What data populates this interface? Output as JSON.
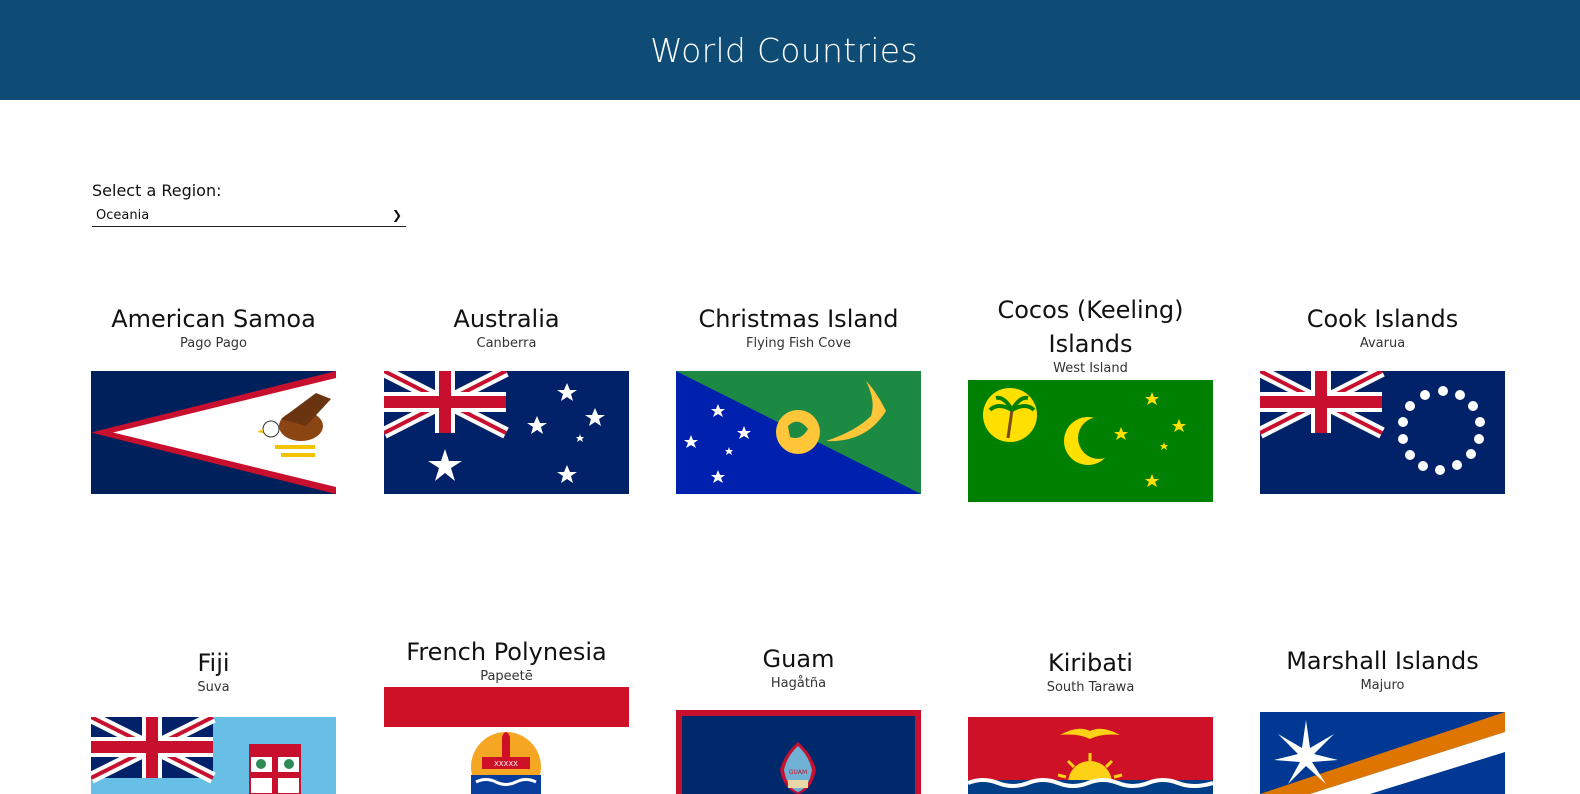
{
  "header": {
    "title": "World Countries"
  },
  "region_filter": {
    "label": "Select a Region:",
    "selected": "Oceania"
  },
  "countries": [
    {
      "name": "American Samoa",
      "capital": "Pago Pago",
      "flag_icon": "american-samoa-flag"
    },
    {
      "name": "Australia",
      "capital": "Canberra",
      "flag_icon": "australia-flag"
    },
    {
      "name": "Christmas Island",
      "capital": "Flying Fish Cove",
      "flag_icon": "christmas-island-flag"
    },
    {
      "name": "Cocos (Keeling) Islands",
      "capital": "West Island",
      "flag_icon": "cocos-keeling-islands-flag"
    },
    {
      "name": "Cook Islands",
      "capital": "Avarua",
      "flag_icon": "cook-islands-flag"
    },
    {
      "name": "Fiji",
      "capital": "Suva",
      "flag_icon": "fiji-flag"
    },
    {
      "name": "French Polynesia",
      "capital": "Papeetē",
      "flag_icon": "french-polynesia-flag"
    },
    {
      "name": "Guam",
      "capital": "Hagåtña",
      "flag_icon": "guam-flag"
    },
    {
      "name": "Kiribati",
      "capital": "South Tarawa",
      "flag_icon": "kiribati-flag"
    },
    {
      "name": "Marshall Islands",
      "capital": "Majuro",
      "flag_icon": "marshall-islands-flag"
    }
  ],
  "colors": {
    "header_bg": "#0f4c75",
    "header_text": "#ffffff"
  }
}
